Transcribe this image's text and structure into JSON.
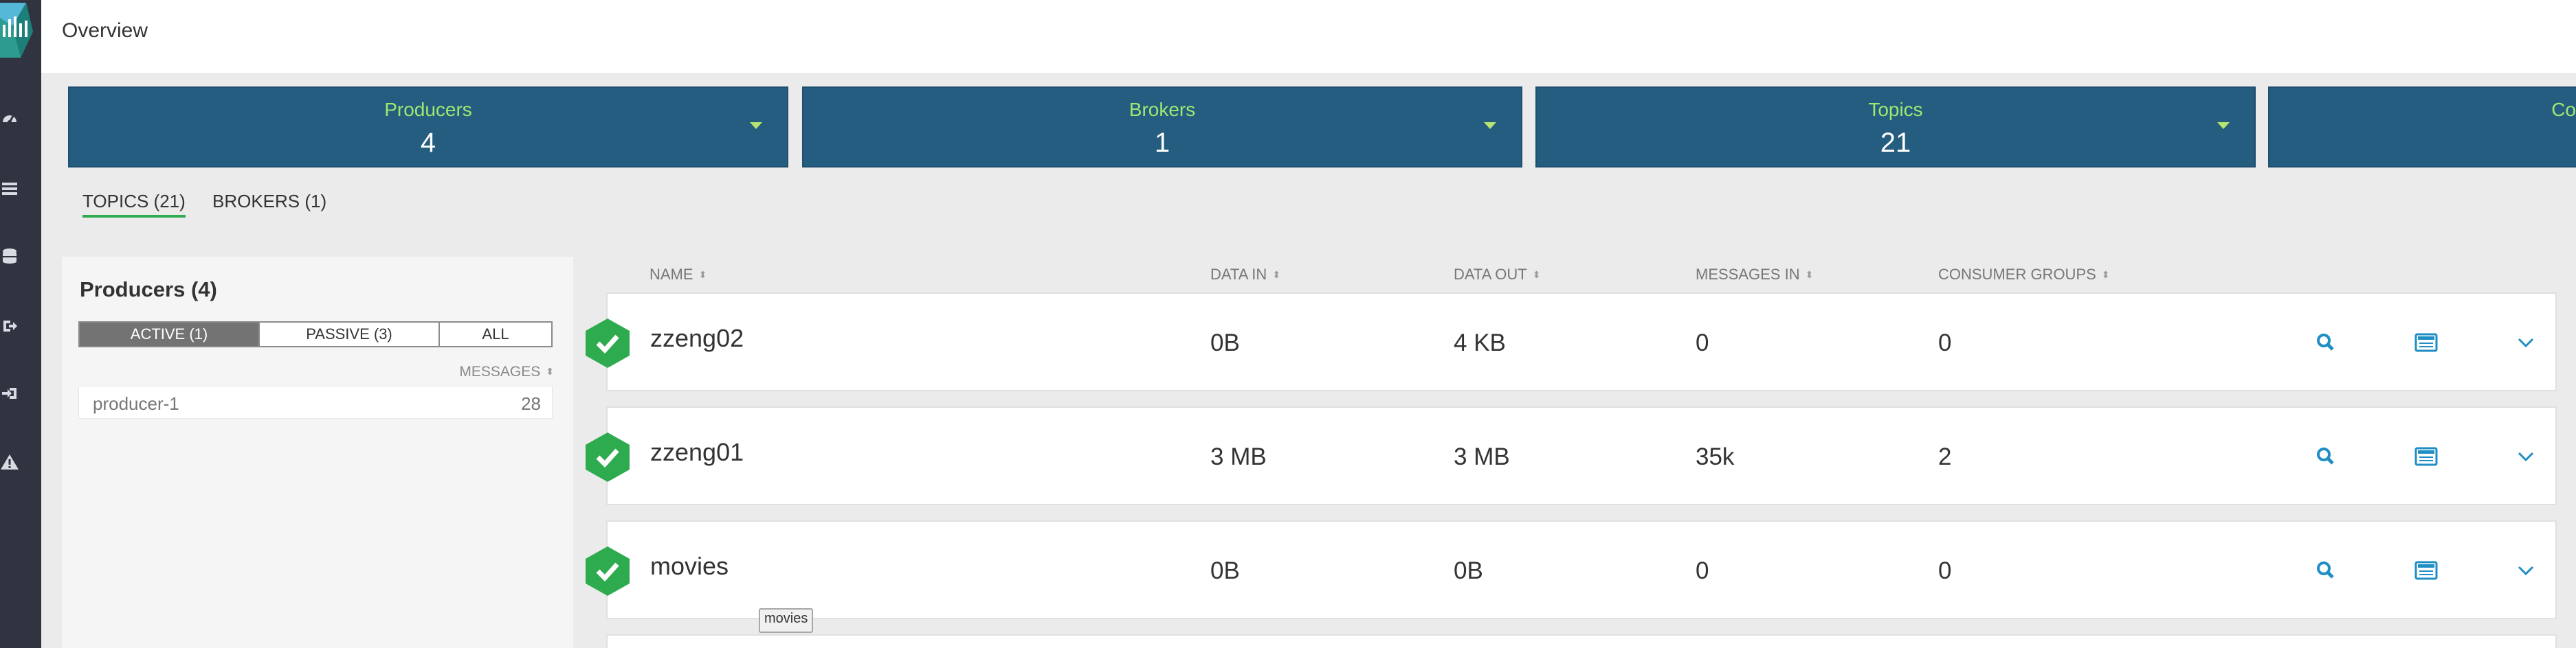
{
  "header": {
    "title": "Overview"
  },
  "summary": [
    {
      "label": "Producers",
      "value": "4"
    },
    {
      "label": "Brokers",
      "value": "1"
    },
    {
      "label": "Topics",
      "value": "21"
    },
    {
      "label": "Co",
      "value": ""
    }
  ],
  "tabs": [
    {
      "label": "TOPICS (21)",
      "active": true
    },
    {
      "label": "BROKERS (1)",
      "active": false
    }
  ],
  "producers": {
    "title": "Producers (4)",
    "filters": [
      "ACTIVE (1)",
      "PASSIVE (3)",
      "ALL"
    ],
    "messages_header": "MESSAGES",
    "rows": [
      {
        "name": "producer-1",
        "messages": "28"
      }
    ]
  },
  "topics": {
    "columns": [
      "NAME",
      "DATA IN",
      "DATA OUT",
      "MESSAGES IN",
      "CONSUMER GROUPS"
    ],
    "rows": [
      {
        "name": "zzeng02",
        "data_in": "0B",
        "data_out": "4 KB",
        "messages_in": "0",
        "consumer_groups": "0"
      },
      {
        "name": "zzeng01",
        "data_in": "3 MB",
        "data_out": "3 MB",
        "messages_in": "35k",
        "consumer_groups": "2"
      },
      {
        "name": "movies",
        "data_in": "0B",
        "data_out": "0B",
        "messages_in": "0",
        "consumer_groups": "0"
      }
    ]
  },
  "tooltip": {
    "text": "movies"
  },
  "icons": {
    "sidebar": [
      "dashboard-icon",
      "list-icon",
      "database-icon",
      "sign-out-icon",
      "sign-in-icon",
      "warning-icon"
    ],
    "row_actions": [
      "search-icon",
      "profile-icon",
      "chevron-down-icon"
    ]
  },
  "colors": {
    "sidebar": "#2f3440",
    "card": "#255d80",
    "card_label": "#9fe870",
    "status_ok": "#2eab4f",
    "action": "#1f8ec4"
  }
}
